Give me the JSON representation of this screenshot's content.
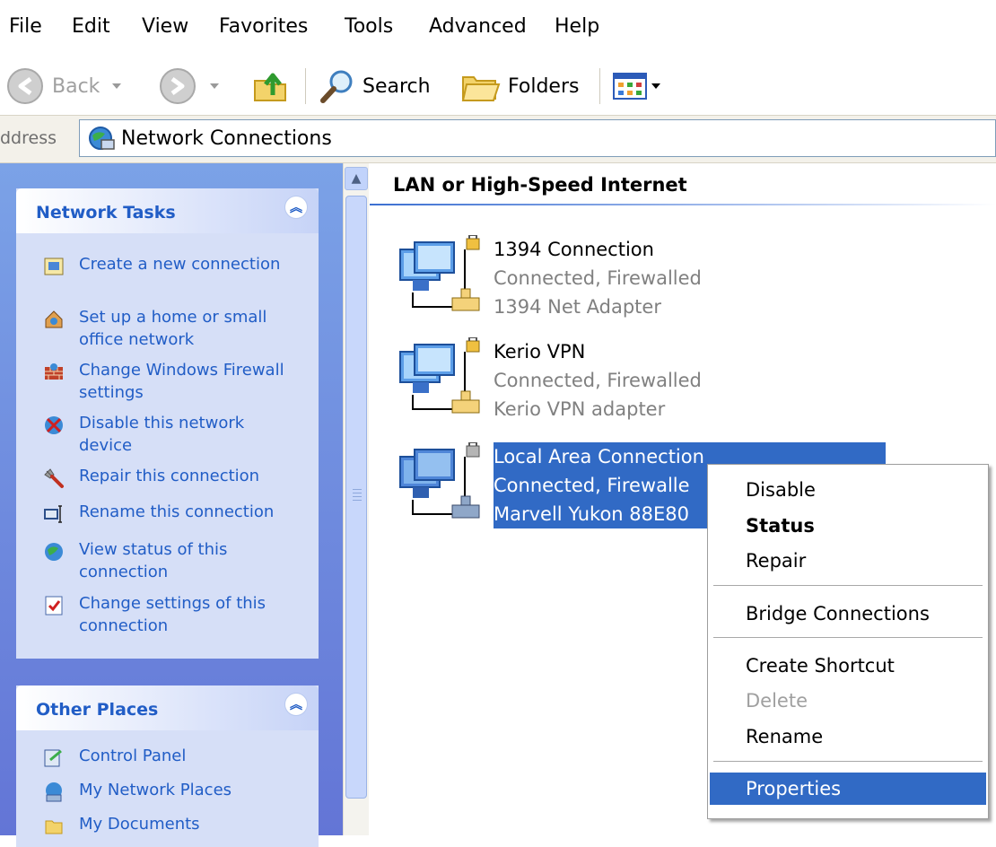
{
  "menu": [
    "File",
    "Edit",
    "View",
    "Favorites",
    "Tools",
    "Advanced",
    "Help"
  ],
  "toolbar": {
    "back_label": "Back",
    "search_label": "Search",
    "folders_label": "Folders"
  },
  "address": {
    "label": "ddress",
    "value": "Network Connections"
  },
  "network_tasks": {
    "title": "Network Tasks",
    "items": [
      {
        "label": "Create a new connection",
        "icon": "new-connection-icon"
      },
      {
        "label": "Set up a home or small office network",
        "icon": "home-network-icon"
      },
      {
        "label": "Change Windows Firewall settings",
        "icon": "firewall-icon"
      },
      {
        "label": "Disable this network device",
        "icon": "disable-device-icon"
      },
      {
        "label": "Repair this connection",
        "icon": "repair-icon"
      },
      {
        "label": "Rename this connection",
        "icon": "rename-icon"
      },
      {
        "label": "View status of this connection",
        "icon": "status-icon"
      },
      {
        "label": "Change settings of this connection",
        "icon": "settings-icon"
      }
    ]
  },
  "other_places": {
    "title": "Other Places",
    "items": [
      {
        "label": "Control Panel",
        "icon": "control-panel-icon"
      },
      {
        "label": "My Network Places",
        "icon": "network-places-icon"
      },
      {
        "label": "My Documents",
        "icon": "documents-icon"
      }
    ]
  },
  "content": {
    "group_title": "LAN or High-Speed Internet",
    "connections": [
      {
        "name": "1394 Connection",
        "status": "Connected, Firewalled",
        "device": "1394 Net Adapter"
      },
      {
        "name": "Kerio VPN",
        "status": "Connected, Firewalled",
        "device": "Kerio VPN adapter"
      },
      {
        "name": "Local Area Connection",
        "status": "Connected, Firewalle",
        "device": "Marvell Yukon 88E80"
      }
    ]
  },
  "context_menu": {
    "items": [
      "Disable",
      "Status",
      "Repair",
      "Bridge Connections",
      "Create Shortcut",
      "Delete",
      "Rename",
      "Properties"
    ]
  },
  "colors": {
    "task_link": "#215dc6",
    "selection": "#316ac5",
    "pane_top": "#7ba2e7",
    "pane_bottom": "#6375d6"
  }
}
